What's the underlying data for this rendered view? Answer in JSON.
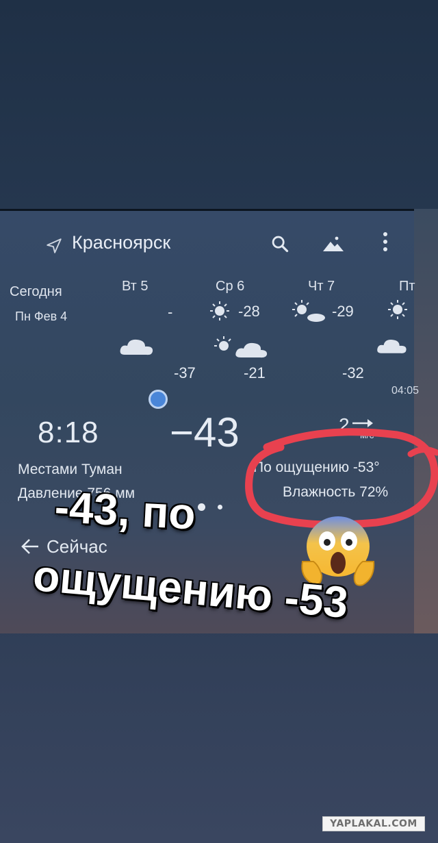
{
  "app": {
    "city": "Красноярск",
    "icons": {
      "location": "location-arrow-icon",
      "search": "search-icon",
      "landscape": "mountain-icon",
      "more": "more-vert-icon"
    }
  },
  "forecast": {
    "today": {
      "label": "Сегодня",
      "date": "Пн Фев 4"
    },
    "days": [
      {
        "label": "Вт 5",
        "temp_day": "-",
        "temp_night": "-37"
      },
      {
        "label": "Ср 6",
        "temp_day": "-28",
        "temp_night": "-21"
      },
      {
        "label": "Чт 7",
        "temp_day": "-29",
        "temp_night": "-32"
      },
      {
        "label": "Пт",
        "temp_day": "",
        "temp_night": ""
      }
    ],
    "sunset": "04:05"
  },
  "current": {
    "time": "8:18",
    "temperature": "−43",
    "condition": "Местами Туман",
    "pressure": "Давление 756 мм",
    "feels_like": "По ощущению -53°",
    "humidity": "Влажность 72%",
    "wind": "2",
    "wind_unit": "м/с"
  },
  "nav": {
    "back_label": "Сейчас"
  },
  "overlay": {
    "line1": "-43, по",
    "line2": "ощущению -53",
    "emoji": "😱",
    "circle_color": "#e8414f"
  },
  "watermark": "YAPLAKAL.COM"
}
